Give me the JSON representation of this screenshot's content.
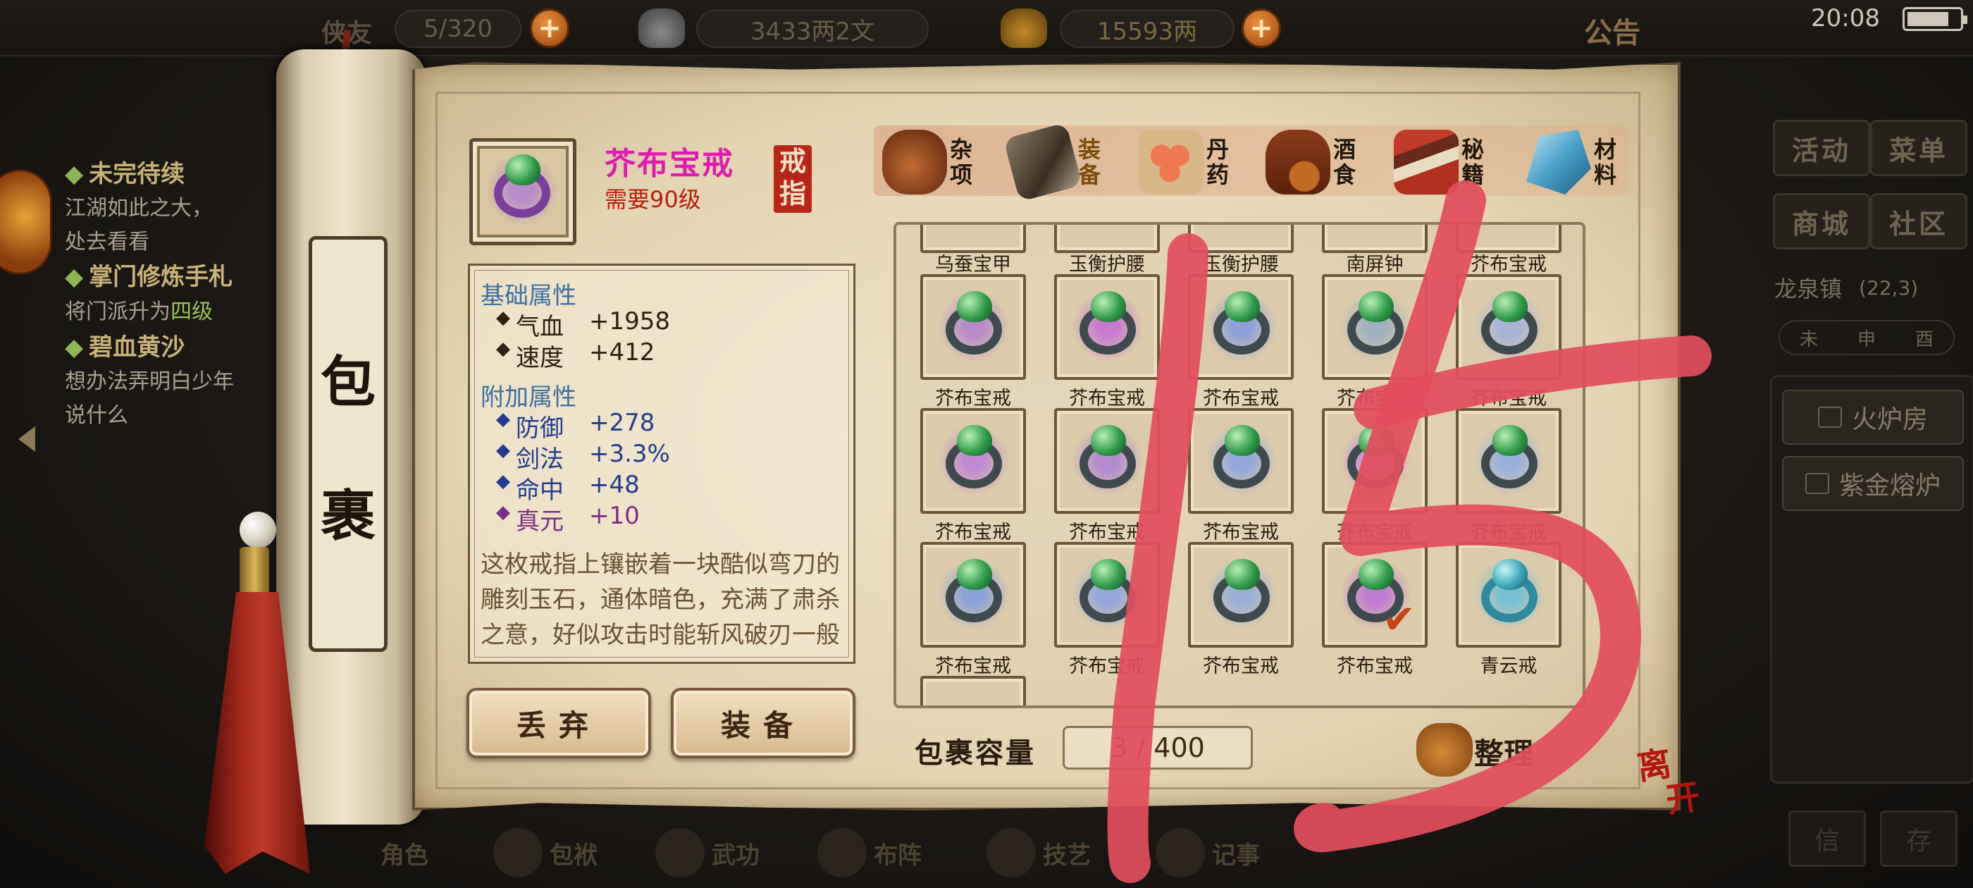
{
  "status_bar": {
    "friends_label": "侠友",
    "friends_count": "5/320",
    "silver": "3433两2文",
    "gold": "15593两",
    "notice": "公告",
    "time": "20:08"
  },
  "quests": [
    {
      "title": "未完待续",
      "desc": [
        "江湖如此之大，",
        "处去看看"
      ]
    },
    {
      "title": "掌门修炼手札",
      "desc_prefix": "将门派升为",
      "desc_highlight": "四级"
    },
    {
      "title": "碧血黄沙",
      "desc": [
        "想办法弄明白少年",
        "说什么"
      ]
    }
  ],
  "side_menu": {
    "activity": "活动",
    "menu": "菜单",
    "shop": "商城",
    "community": "社区",
    "location": "龙泉镇",
    "coords": "(22,3)",
    "timeline": [
      "未",
      "申",
      "酉"
    ],
    "places": [
      "火炉房",
      "紫金熔炉"
    ],
    "bottom_buttons": [
      "信",
      "存"
    ]
  },
  "bottom_nav": [
    "角色",
    "包袱",
    "武功",
    "布阵",
    "技艺",
    "记事"
  ],
  "scroll": {
    "title_top": "包",
    "title_bottom": "裹"
  },
  "selected_item": {
    "name": "芥布宝戒",
    "level_req": "需要90级",
    "type_seal": [
      "戒",
      "指"
    ],
    "base_header": "基础属性",
    "base_attrs": [
      {
        "key": "气血",
        "value": "+1958"
      },
      {
        "key": "速度",
        "value": "+412"
      }
    ],
    "extra_header": "附加属性",
    "extra_attrs": [
      {
        "key": "防御",
        "value": "+278",
        "tone": "blue"
      },
      {
        "key": "剑法",
        "value": "+3.3%",
        "tone": "blue"
      },
      {
        "key": "命中",
        "value": "+48",
        "tone": "blue"
      },
      {
        "key": "真元",
        "value": "+10",
        "tone": "purple"
      }
    ],
    "description": "这枚戒指上镶嵌着一块酷似弯刀的雕刻玉石，通体暗色，充满了肃杀之意，好似攻击时能斩风破刃一般"
  },
  "actions": {
    "discard": "丢弃",
    "equip": "装备"
  },
  "tabs": [
    {
      "label": "杂项",
      "icon": "jar-icon"
    },
    {
      "label": "装备",
      "icon": "equipment-icon",
      "active": true
    },
    {
      "label": "丹药",
      "icon": "pill-icon"
    },
    {
      "label": "酒食",
      "icon": "wine-food-icon"
    },
    {
      "label": "秘籍",
      "icon": "book-icon"
    },
    {
      "label": "材料",
      "icon": "crystal-icon"
    }
  ],
  "inventory": {
    "top_row_labels": [
      "乌蚕宝甲",
      "玉衡护腰",
      "玉衡护腰",
      "南屏钟",
      "芥布宝戒"
    ],
    "rows": [
      [
        "芥布宝戒",
        "芥布宝戒",
        "芥布宝戒",
        "芥布宝戒",
        "芥布宝戒"
      ],
      [
        "芥布宝戒",
        "芥布宝戒",
        "芥布宝戒",
        "芥布宝戒",
        "芥布宝戒"
      ],
      [
        "芥布宝戒",
        "芥布宝戒",
        "芥布宝戒",
        "芥布宝戒",
        "青云戒"
      ]
    ],
    "aura_colors": [
      [
        "#b88ac9",
        "#c77ad0",
        "#8fa0d8",
        "#a0b0c0",
        "#a9b3d8"
      ],
      [
        "#c08ad2",
        "#b28ad0",
        "#94a7dc",
        "#c58ad6",
        "#9ab0dc"
      ],
      [
        "#8aa2d8",
        "#94a6da",
        "#9aaed8",
        "#c07ad0",
        "#7ac0d0"
      ]
    ],
    "checked_cell": [
      2,
      3
    ]
  },
  "capacity": {
    "label": "包裹容量",
    "value": "3 / 400"
  },
  "sort_label": "整理",
  "leave_label": [
    "离",
    "开"
  ],
  "overlay_text": "15",
  "colors": {
    "accent_red": "#e24e5c",
    "item_name": "#e01bb0",
    "level_req": "#b5200f"
  }
}
